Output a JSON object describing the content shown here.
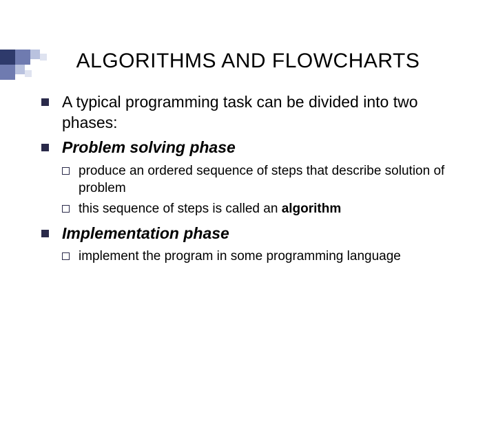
{
  "title": "ALGORITHMS AND FLOWCHARTS",
  "bullets": {
    "b1": "A typical programming task can be divided into two phases:",
    "b2": "Problem solving phase",
    "b2_sub1_a": "produce an ordered sequence of steps that describe solution of problem",
    "b2_sub2_a": "this sequence of steps is called an ",
    "b2_sub2_b": "algorithm",
    "b3": "Implementation phase",
    "b3_sub1_a": "implement the program in some programming language"
  },
  "deco": {
    "colors": {
      "dark": "#2e3a6b",
      "mid": "#6f7bb0",
      "light": "#b9c2df",
      "pale": "#dfe3f0"
    }
  }
}
